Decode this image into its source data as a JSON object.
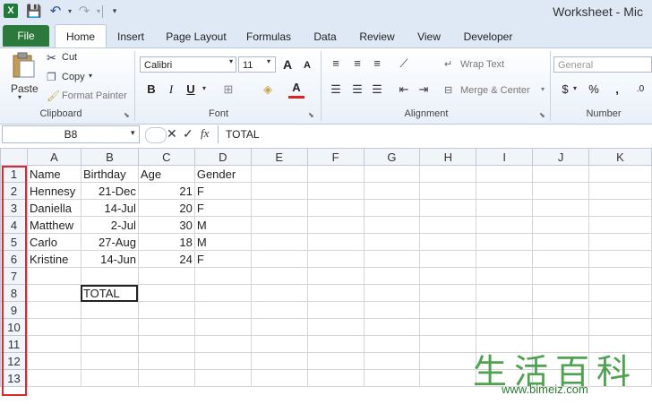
{
  "window": {
    "title": "Worksheet - Mic"
  },
  "qat": {
    "undo_dd": "▾",
    "redo_dd": "▾",
    "customize": "▾"
  },
  "tabs": [
    "File",
    "Home",
    "Insert",
    "Page Layout",
    "Formulas",
    "Data",
    "Review",
    "View",
    "Developer"
  ],
  "ribbon": {
    "clipboard": {
      "paste": "Paste",
      "paste_dd": "▾",
      "cut": "Cut",
      "copy": "Copy",
      "copy_dd": "▾",
      "format_painter": "Format Painter",
      "label": "Clipboard"
    },
    "font": {
      "name": "Calibri",
      "size": "11",
      "grow": "A",
      "shrink": "A",
      "bold": "B",
      "italic": "I",
      "underline": "U",
      "label": "Font",
      "font_color": "A"
    },
    "alignment": {
      "wrap": "Wrap Text",
      "merge": "Merge & Center",
      "label": "Alignment"
    },
    "number": {
      "format": "General",
      "currency": "$",
      "percent": "%",
      "comma": ",",
      "label": "Number"
    }
  },
  "formula_bar": {
    "name_box": "B8",
    "fx": "fx",
    "content": "TOTAL"
  },
  "columns": [
    "A",
    "B",
    "C",
    "D",
    "E",
    "F",
    "G",
    "H",
    "I",
    "J",
    "K"
  ],
  "rows": [
    {
      "num": "1",
      "cells": [
        "Name",
        "Birthday",
        "Age",
        "Gender"
      ]
    },
    {
      "num": "2",
      "cells": [
        "Hennesy",
        "21-Dec",
        "21",
        "F"
      ]
    },
    {
      "num": "3",
      "cells": [
        "Daniella",
        "14-Jul",
        "20",
        "F"
      ]
    },
    {
      "num": "4",
      "cells": [
        "Matthew",
        "2-Jul",
        "30",
        "M"
      ]
    },
    {
      "num": "5",
      "cells": [
        "Carlo",
        "27-Aug",
        "18",
        "M"
      ]
    },
    {
      "num": "6",
      "cells": [
        "Kristine",
        "14-Jun",
        "24",
        "F"
      ]
    },
    {
      "num": "7",
      "cells": [
        "",
        "",
        "",
        ""
      ]
    },
    {
      "num": "8",
      "cells": [
        "",
        "TOTAL",
        "",
        ""
      ]
    },
    {
      "num": "9",
      "cells": [
        "",
        "",
        "",
        ""
      ]
    },
    {
      "num": "10",
      "cells": [
        "",
        "",
        "",
        ""
      ]
    },
    {
      "num": "11",
      "cells": [
        "",
        "",
        "",
        ""
      ]
    },
    {
      "num": "12",
      "cells": [
        "",
        "",
        "",
        ""
      ]
    },
    {
      "num": "13",
      "cells": [
        "",
        "",
        "",
        ""
      ]
    }
  ],
  "watermark": {
    "chars": "生活百科",
    "url": "www.bimeiz.com"
  },
  "colors": {
    "file_tab": "#2b7a3b",
    "highlight_border": "#d9282f",
    "selected_header": "#f8d985"
  }
}
